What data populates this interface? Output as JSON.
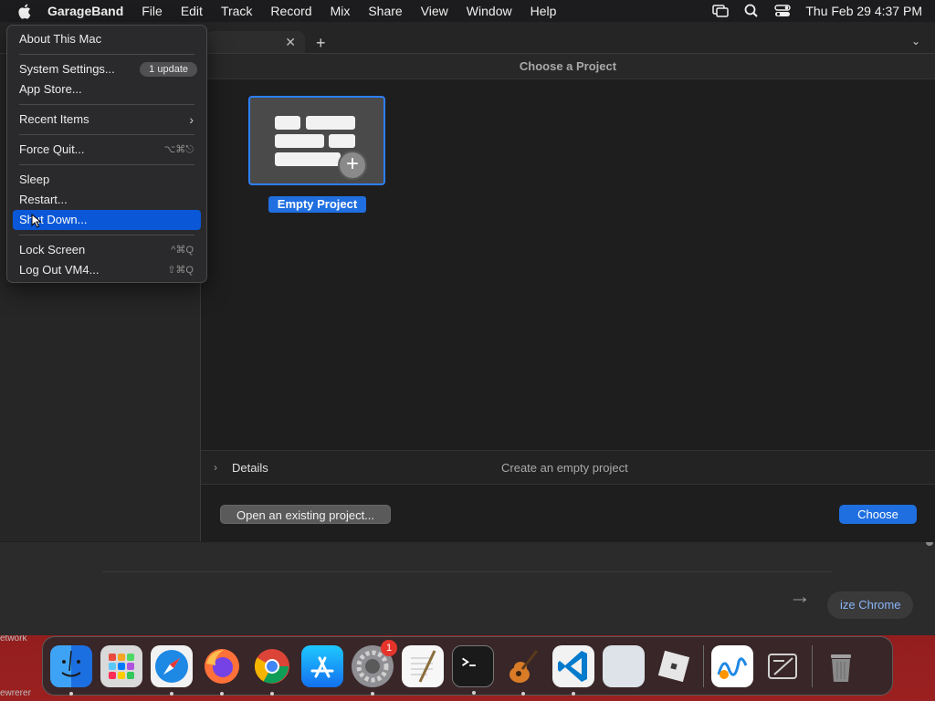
{
  "menubar": {
    "app_name": "GarageBand",
    "items": [
      "File",
      "Edit",
      "Track",
      "Record",
      "Mix",
      "Share",
      "View",
      "Window",
      "Help"
    ],
    "clock": "Thu Feb 29  4:37 PM"
  },
  "apple_menu": {
    "about": "About This Mac",
    "system_settings": "System Settings...",
    "update_badge": "1 update",
    "app_store": "App Store...",
    "recent_items": "Recent Items",
    "force_quit": "Force Quit...",
    "force_quit_shortcut": "⌥⌘⎋",
    "sleep": "Sleep",
    "restart": "Restart...",
    "shut_down": "Shut Down...",
    "lock_screen": "Lock Screen",
    "lock_screen_shortcut": "^⌘Q",
    "log_out": "Log Out VM4...",
    "log_out_shortcut": "⇧⌘Q"
  },
  "chooser": {
    "title": "Choose a Project",
    "template_label": "Empty Project",
    "details_label": "Details",
    "details_description": "Create an empty project",
    "open_button": "Open an existing project...",
    "choose_button": "Choose"
  },
  "background": {
    "customize_button": "ize Chrome",
    "desktop_text_1": "etwork",
    "desktop_text_2": "ewrerer"
  },
  "dock": {
    "system_settings_badge": "1"
  },
  "colors": {
    "accent": "#1f6fe0",
    "menu_highlight": "#0a58d8",
    "badge": "#e5352b"
  }
}
